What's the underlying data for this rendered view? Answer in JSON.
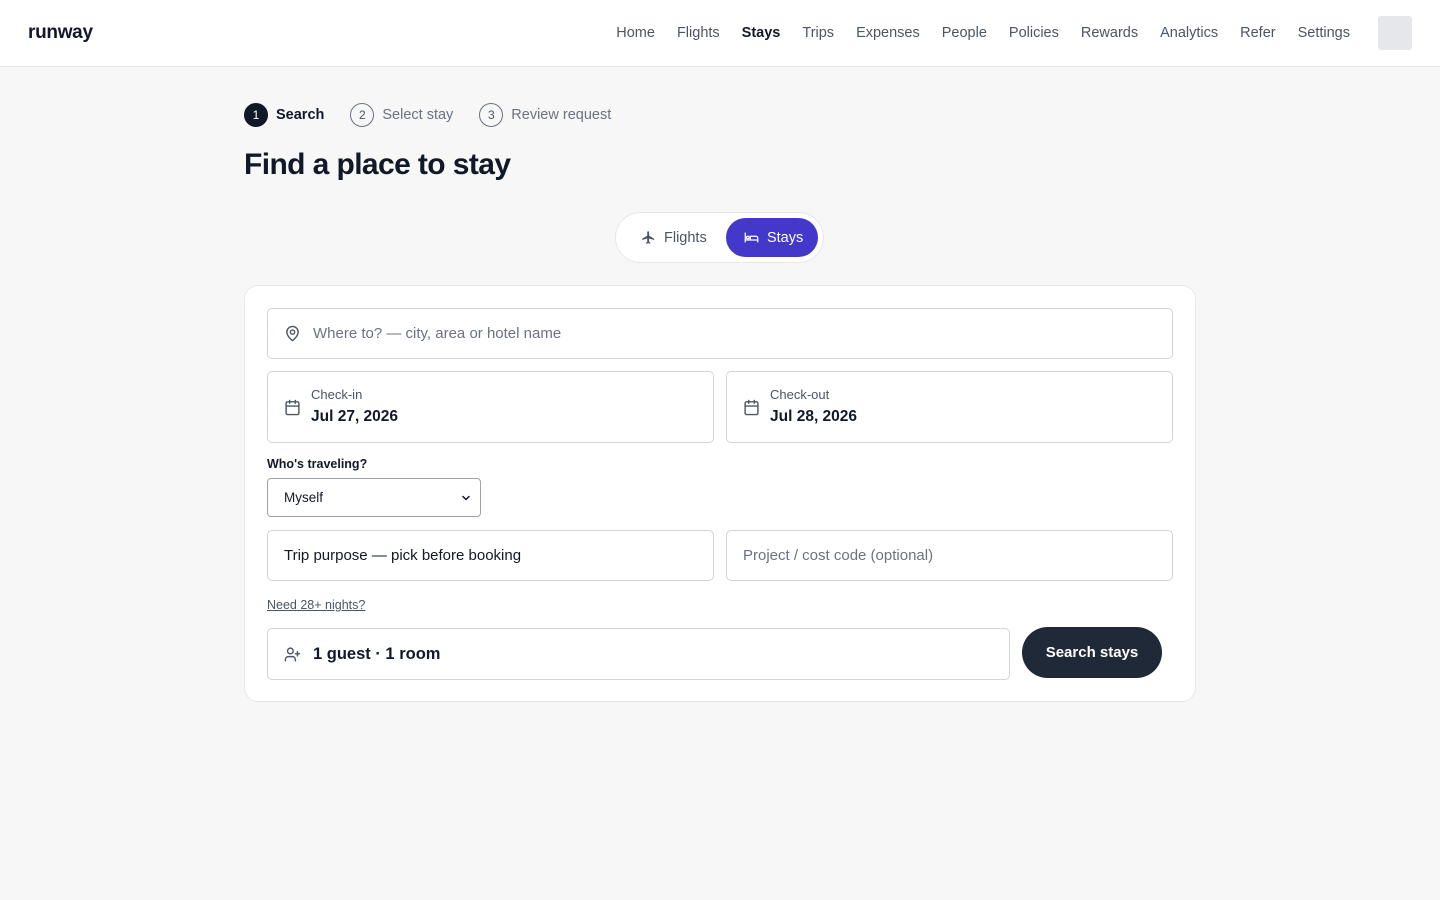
{
  "header": {
    "logo": "runway",
    "nav": [
      {
        "label": "Home",
        "active": false
      },
      {
        "label": "Flights",
        "active": false
      },
      {
        "label": "Stays",
        "active": true
      },
      {
        "label": "Trips",
        "active": false
      },
      {
        "label": "Expenses",
        "active": false
      },
      {
        "label": "People",
        "active": false
      },
      {
        "label": "Policies",
        "active": false
      },
      {
        "label": "Rewards",
        "active": false
      },
      {
        "label": "Analytics",
        "active": false
      },
      {
        "label": "Refer",
        "active": false
      },
      {
        "label": "Settings",
        "active": false
      }
    ]
  },
  "stepper": {
    "steps": [
      {
        "number": "1",
        "label": "Search",
        "active": true
      },
      {
        "number": "2",
        "label": "Select stay",
        "active": false
      },
      {
        "number": "3",
        "label": "Review request",
        "active": false
      }
    ]
  },
  "page_title": "Find a place to stay",
  "mode_toggle": {
    "flights_label": "Flights",
    "stays_label": "Stays",
    "selected": "Stays"
  },
  "form": {
    "destination_placeholder": "Where to? — city, area or hotel name",
    "check_in": {
      "label": "Check-in",
      "value": "Jul 27, 2026"
    },
    "check_out": {
      "label": "Check-out",
      "value": "Jul 28, 2026"
    },
    "who_traveling": {
      "label": "Who's traveling?",
      "value": "Myself"
    },
    "trip_purpose": "Trip purpose — pick before booking",
    "project_placeholder": "Project / cost code (optional)",
    "long_stay_link": "Need 28+ nights?",
    "guests": "1 guest · 1 room",
    "search_button": "Search stays"
  },
  "colors": {
    "accent": "#4338ca",
    "primary_button": "#1f2937",
    "background": "#f7f7f8"
  }
}
